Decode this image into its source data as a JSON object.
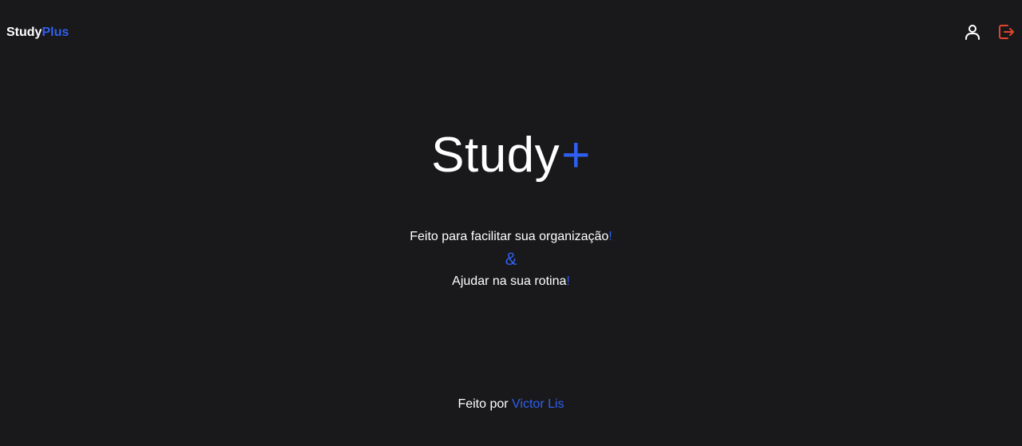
{
  "header": {
    "logo_main": "Study",
    "logo_accent": "Plus",
    "profile_icon": "user-icon",
    "logout_icon": "logout-icon"
  },
  "hero": {
    "title": "Study",
    "title_accent": "+"
  },
  "tagline": {
    "line1": "Feito para facilitar sua organização",
    "line1_mark": "!",
    "ampersand": "&",
    "line2": "Ajudar na sua rotina",
    "line2_mark": "!"
  },
  "footer": {
    "prefix": "Feito por",
    "author": "Victor Lis"
  },
  "colors": {
    "background": "#19191b",
    "accent": "#2f5ff0",
    "logout": "#e5432d",
    "text": "#ffffff"
  }
}
